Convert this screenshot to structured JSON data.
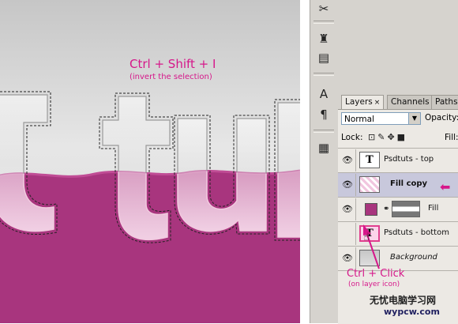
{
  "canvas": {
    "annotation_title": "Ctrl + Shift + I",
    "annotation_sub": "(invert the selection)",
    "colors": {
      "magenta": "#a8357e",
      "annotation": "#d6178a",
      "background_gray": "#d8d8d8"
    }
  },
  "tools": {
    "icons": [
      "scissors-icon",
      "stamp-icon",
      "eraser-icon",
      "text-icon",
      "pen-icon",
      "notes-icon"
    ]
  },
  "layers_panel": {
    "tabs": [
      {
        "label": "Layers",
        "active": true,
        "close": "×"
      },
      {
        "label": "Channels"
      },
      {
        "label": "Paths"
      }
    ],
    "blend_mode": "Normal",
    "opacity_label": "Opacity:",
    "lock_label": "Lock:",
    "fill_label": "Fill:",
    "layers": [
      {
        "name": "Psdtuts - top",
        "type": "text",
        "visible": true
      },
      {
        "name": "Fill copy",
        "type": "pattern",
        "visible": true,
        "selected": true
      },
      {
        "name": "Fill",
        "type": "adjustment",
        "visible": true
      },
      {
        "name": "Psdtuts - bottom",
        "type": "text",
        "visible": false
      },
      {
        "name": "Background",
        "type": "image",
        "visible": true,
        "italic": true
      }
    ]
  },
  "annotations": {
    "ctrl_click": "Ctrl + Click",
    "on_layer_icon": "(on layer icon)"
  },
  "watermark": {
    "cn": "无忧电脑学习网",
    "url": "wypcw.com"
  }
}
